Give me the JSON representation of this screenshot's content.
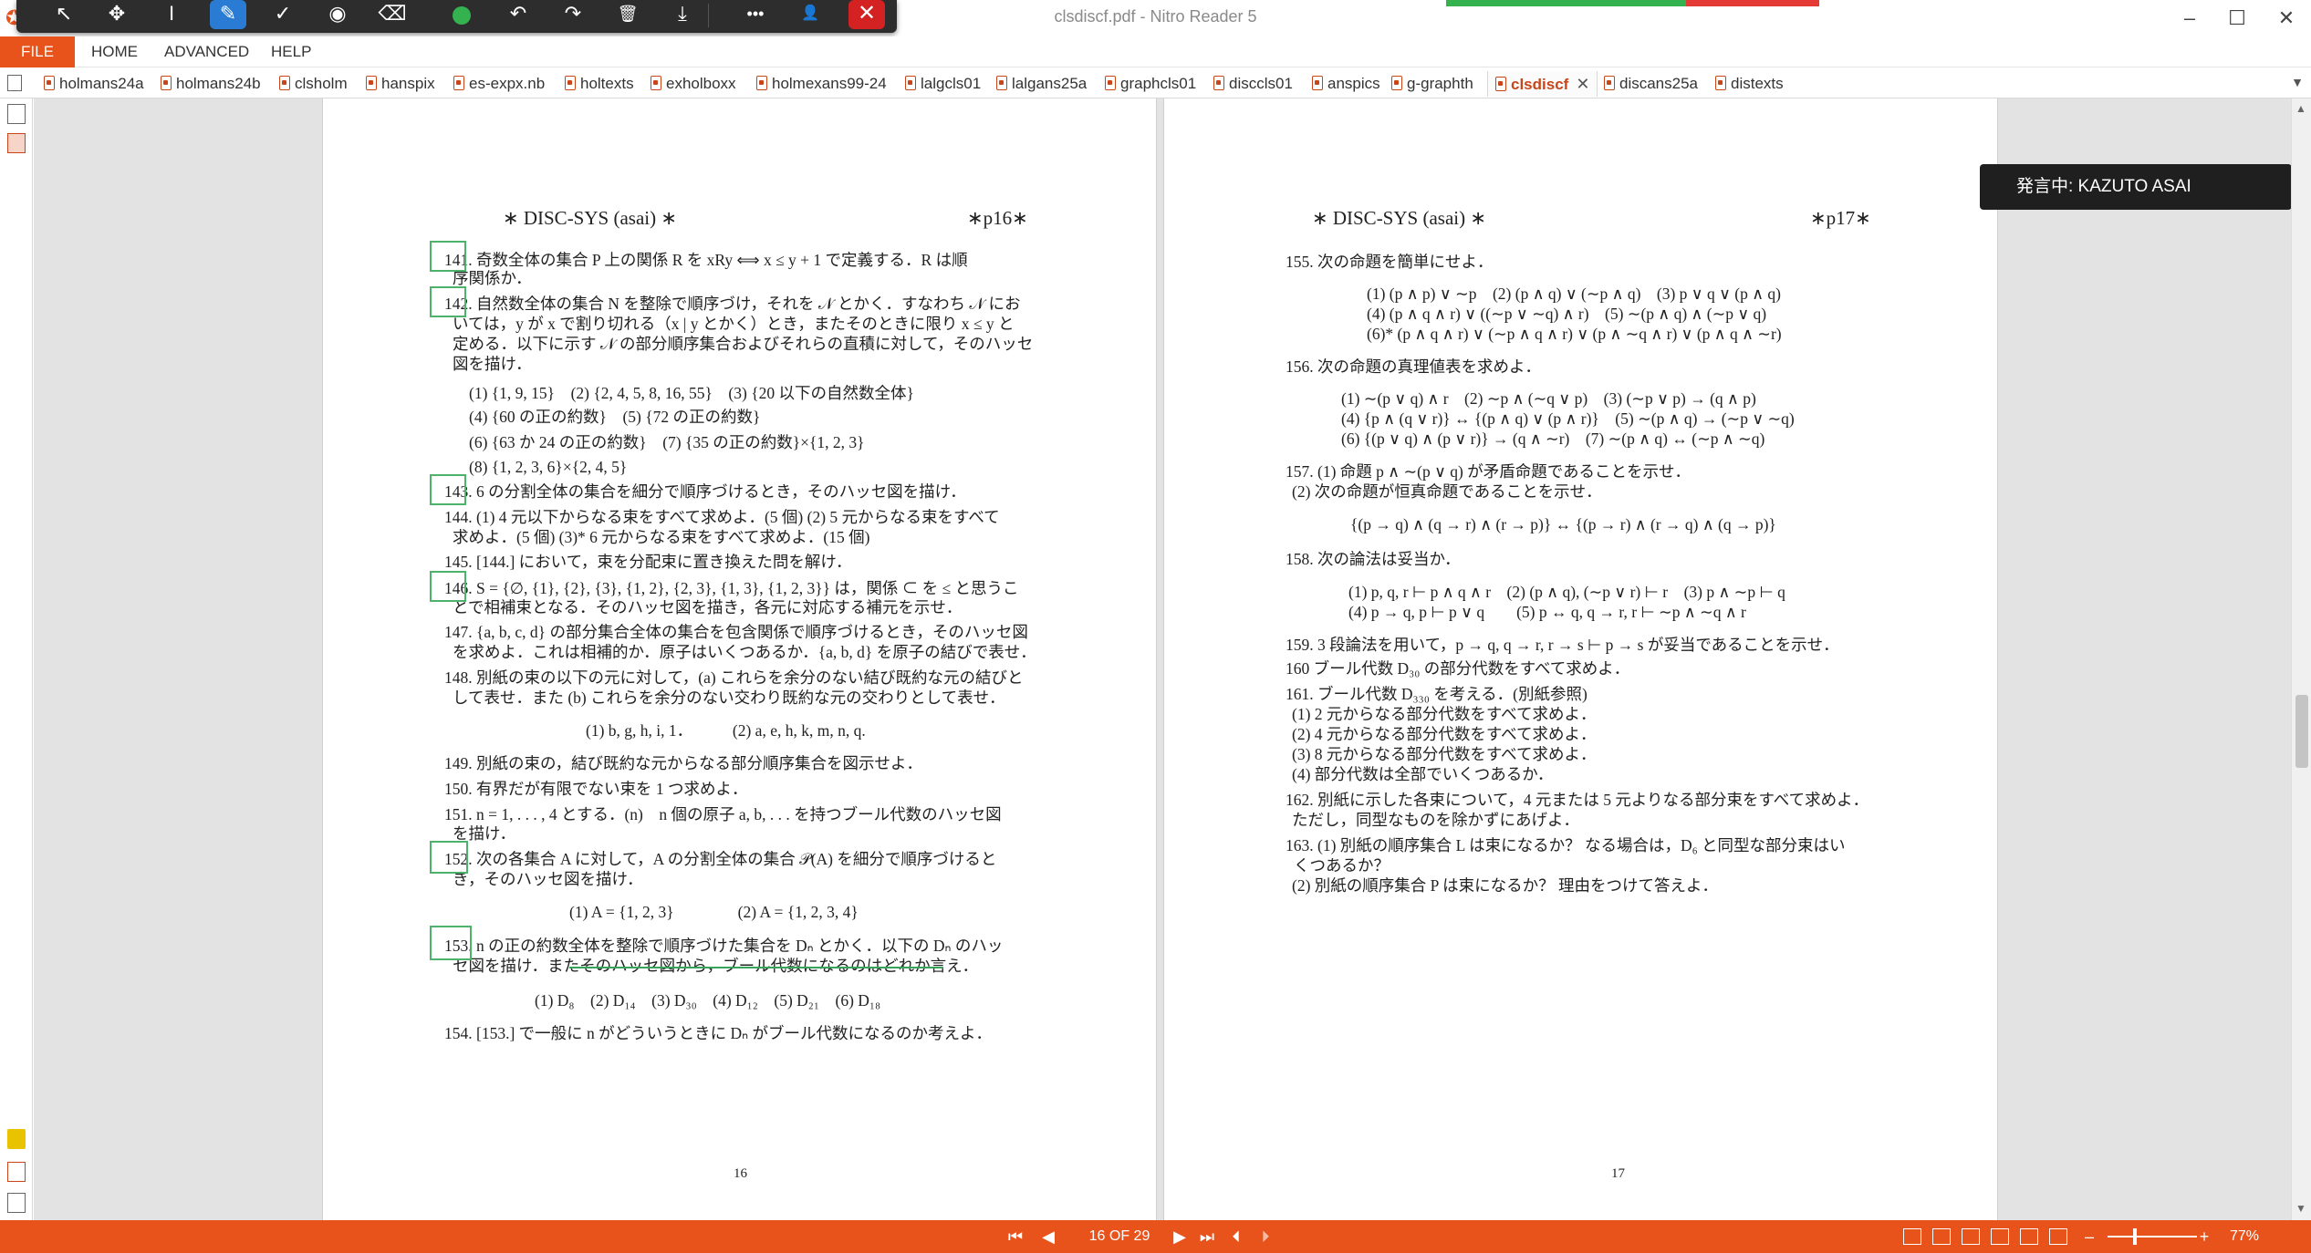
{
  "window": {
    "title": "clsdiscf.pdf - Nitro Reader 5",
    "minimize_glyph": "–",
    "maximize_glyph": "☐",
    "close_glyph": "✕"
  },
  "colors": {
    "brand": "#e8531c",
    "toolbar_bg": "#2d2d2d",
    "active_blue": "#2a7bd4",
    "mark_green": "#4db26a",
    "progress_green": "#33b24f",
    "progress_red": "#e53935"
  },
  "float_toolbar": {
    "icons": [
      "pointer-icon",
      "move-icon",
      "text-cursor-icon",
      "pen-icon",
      "check-icon",
      "stamp-icon",
      "eraser-icon",
      "color-dot-icon",
      "undo-icon",
      "redo-icon",
      "trash-icon",
      "download-icon",
      "more-icon",
      "user-settings-icon",
      "close-icon"
    ],
    "glyphs": {
      "pointer": "↖",
      "move": "✥",
      "text": "I",
      "pen": "✎",
      "check": "✓",
      "stamp": "◉",
      "eraser": "⌫",
      "undo": "↶",
      "redo": "↷",
      "trash": "🗑",
      "download": "⤓",
      "more": "•••",
      "user": "👤",
      "close": "✕"
    }
  },
  "menubar": {
    "file": "FILE",
    "items": [
      "HOME",
      "ADVANCED",
      "HELP"
    ]
  },
  "tabs": [
    {
      "label": "holmans24a"
    },
    {
      "label": "holmans24b"
    },
    {
      "label": "clsholm"
    },
    {
      "label": "hanspix"
    },
    {
      "label": "es-expx.nb"
    },
    {
      "label": "holtexts"
    },
    {
      "label": "exholboxx"
    },
    {
      "label": "holmexans99-24"
    },
    {
      "label": "lalgcls01"
    },
    {
      "label": "lalgans25a"
    },
    {
      "label": "graphcls01"
    },
    {
      "label": "disccls01"
    },
    {
      "label": "anspics"
    },
    {
      "label": "g-graphth"
    },
    {
      "label": "clsdiscf"
    },
    {
      "label": "discans25a"
    },
    {
      "label": "distexts"
    }
  ],
  "active_tab": "clsdiscf",
  "speaker": {
    "label": "発言中: KAZUTO ASAI"
  },
  "page_left": {
    "header_left": "∗ DISC-SYS (asai) ∗",
    "header_right": "∗p16∗",
    "lines": [
      "141. 奇数全体の集合 P 上の関係 R を xRy ⟺ x ≤ y + 1 で定義する．R は順",
      "序関係か．",
      "142. 自然数全体の集合 N を整除で順序づけ，それを 𝒩 とかく．すなわち 𝒩 にお",
      "いては，y が x で割り切れる（x | y とかく）とき，またそのときに限り x ≤ y と",
      "定める．以下に示す 𝒩 の部分順序集合およびそれらの直積に対して，そのハッセ",
      "図を描け．",
      "(1) {1, 9, 15}　(2) {2, 4, 5, 8, 16, 55}　(3) {20 以下の自然数全体}",
      "(4) {60 の正の約数}　(5) {72 の正の約数}",
      "(6) {63 か 24 の正の約数}　(7) {35 の正の約数}×{1, 2, 3}",
      "(8) {1, 2, 3, 6}×{2, 4, 5}",
      "143. 6 の分割全体の集合を細分で順序づけるとき，そのハッセ図を描け．",
      "144. (1) 4 元以下からなる束をすべて求めよ．(5 個) (2) 5 元からなる束をすべて",
      "求めよ．(5 個) (3)* 6 元からなる束をすべて求めよ．(15 個)",
      "145. [144.] において，束を分配束に置き換えた問を解け．",
      "146. S = {∅, {1}, {2}, {3}, {1, 2}, {2, 3}, {1, 3}, {1, 2, 3}} は，関係 ⊂ を ≤ と思うこ",
      "とで相補束となる．そのハッセ図を描き，各元に対応する補元を示せ．",
      "147. {a, b, c, d} の部分集合全体の集合を包含関係で順序づけるとき，そのハッセ図",
      "を求めよ．これは相補的か．原子はいくつあるか．{a, b, d} を原子の結びで表せ．",
      "148. 別紙の束の以下の元に対して，(a) これらを余分のない結び既約な元の結びと",
      "して表せ．また (b) これらを余分のない交わり既約な元の交わりとして表せ．",
      "(1) b, g, h, i, 1．　　　(2) a, e, h, k, m, n, q.",
      "149. 別紙の束の，結び既約な元からなる部分順序集合を図示せよ．",
      "150. 有界だが有限でない束を 1 つ求めよ．",
      "151. n = 1, . . . , 4 とする．(n)　n 個の原子 a, b, . . . を持つブール代数のハッセ図",
      "を描け．",
      "152. 次の各集合 A に対して，A の分割全体の集合 𝒫(A) を細分で順序づけると",
      "き，そのハッセ図を描け．",
      "(1) A = {1, 2, 3}　　　　(2) A = {1, 2, 3, 4}",
      "153. n の正の約数全体を整除で順序づけた集合を Dₙ とかく．以下の Dₙ のハッ",
      "セ図を描け．またそのハッセ図から，ブール代数になるのはどれか言え．",
      "(1) D₈　(2) D₁₄　(3) D₃₀　(4) D₁₂　(5) D₂₁　(6) D₁₈",
      "154. [153.] で一般に n がどういうときに Dₙ がブール代数になるのか考えよ．"
    ],
    "footer": "16"
  },
  "page_right": {
    "header_left": "∗ DISC-SYS (asai) ∗",
    "header_right": "∗p17∗",
    "lines": [
      "155. 次の命題を簡単にせよ．",
      "(1) (p ∧ p) ∨ ∼p　(2) (p ∧ q) ∨ (∼p ∧ q)　(3) p ∨ q ∨ (p ∧ q)",
      "(4) (p ∧ q ∧ r) ∨ ((∼p ∨ ∼q) ∧ r)　(5) ∼(p ∧ q) ∧ (∼p ∨ q)",
      "(6)* (p ∧ q ∧ r) ∨ (∼p ∧ q ∧ r) ∨ (p ∧ ∼q ∧ r) ∨ (p ∧ q ∧ ∼r)",
      "156. 次の命題の真理値表を求めよ．",
      "(1) ∼(p ∨ q) ∧ r　(2) ∼p ∧ (∼q ∨ p)　(3) (∼p ∨ p) → (q ∧ p)",
      "(4) {p ∧ (q ∨ r)} ↔ {(p ∧ q) ∨ (p ∧ r)}　(5) ∼(p ∧ q) → (∼p ∨ ∼q)",
      "(6) {(p ∨ q) ∧ (p ∨ r)} → (q ∧ ∼r)　(7) ∼(p ∧ q) ↔ (∼p ∧ ∼q)",
      "157. (1) 命題 p ∧ ∼(p ∨ q) が矛盾命題であることを示せ．",
      "(2) 次の命題が恒真命題であることを示せ．",
      "{(p → q) ∧ (q → r) ∧ (r → p)} ↔ {(p → r) ∧ (r → q) ∧ (q → p)}",
      "158. 次の論法は妥当か．",
      "(1) p, q, r ⊢ p ∧ q ∧ r　(2) (p ∧ q), (∼p ∨ r) ⊢ r　(3) p ∧ ∼p ⊢ q",
      "(4) p → q, p ⊢ p ∨ q　　(5) p ↔ q, q → r, r ⊢ ∼p ∧ ∼q ∧ r",
      "159. 3 段論法を用いて，p → q, q → r, r → s ⊢ p → s が妥当であることを示せ．",
      "160 ブール代数 D₃₀ の部分代数をすべて求めよ．",
      "161. ブール代数 D₃₃₀ を考える．(別紙参照)",
      "(1) 2 元からなる部分代数をすべて求めよ．",
      "(2) 4 元からなる部分代数をすべて求めよ．",
      "(3) 8 元からなる部分代数をすべて求めよ．",
      "(4) 部分代数は全部でいくつあるか．",
      "162. 別紙に示した各束について，4 元または 5 元よりなる部分束をすべて求めよ．",
      "ただし，同型なものを除かずにあげよ．",
      "163. (1) 別紙の順序集合 L は束になるか？ なる場合は，D₆ と同型な部分束はい",
      "くつあるか？",
      "(2) 別紙の順序集合 P は束になるか？ 理由をつけて答えよ．"
    ],
    "footer": "17"
  },
  "statusbar": {
    "page_indicator": "16 OF 29",
    "zoom_label": "77%",
    "zoom_minus": "–",
    "zoom_plus": "+",
    "nav_glyphs": {
      "first": "⏮",
      "prev": "◀",
      "next": "▶",
      "last": "⏭",
      "back": "⏴",
      "forward": "⏵"
    },
    "zoom_fraction": 0.77
  }
}
